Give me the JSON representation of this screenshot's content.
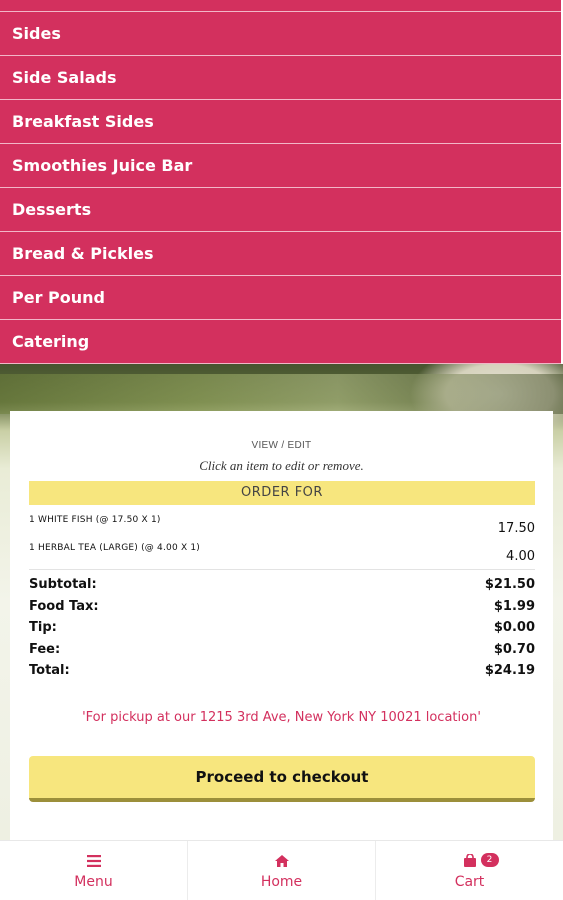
{
  "categories": [
    "Sides",
    "Side Salads",
    "Breakfast Sides",
    "Smoothies Juice Bar",
    "Desserts",
    "Bread & Pickles",
    "Per Pound",
    "Catering"
  ],
  "order": {
    "view_edit": "VIEW / EDIT",
    "hint": "Click an item to edit or remove.",
    "order_for": "ORDER FOR",
    "items": [
      {
        "name": "1 WHITE FISH (@ 17.50 X 1)",
        "price": "17.50"
      },
      {
        "name": "1 HERBAL TEA (LARGE) (@ 4.00 X 1)",
        "price": "4.00"
      }
    ],
    "totals": [
      {
        "label": "Subtotal:",
        "value": "$21.50"
      },
      {
        "label": "Food Tax:",
        "value": "$1.99"
      },
      {
        "label": "Tip:",
        "value": "$0.00"
      },
      {
        "label": "Fee:",
        "value": "$0.70"
      },
      {
        "label": "Total:",
        "value": "$24.19"
      }
    ],
    "pickup_note": "'For pickup at our 1215 3rd Ave, New York NY 10021 location'",
    "checkout_label": "Proceed to checkout"
  },
  "nav": {
    "menu_label": "Menu",
    "home_label": "Home",
    "cart_label": "Cart",
    "cart_count": "2",
    "icons": [
      "menu-icon",
      "home-icon",
      "shopping-bag-icon"
    ]
  },
  "colors": {
    "accent": "#d3305e",
    "highlight": "#f7e67e"
  }
}
